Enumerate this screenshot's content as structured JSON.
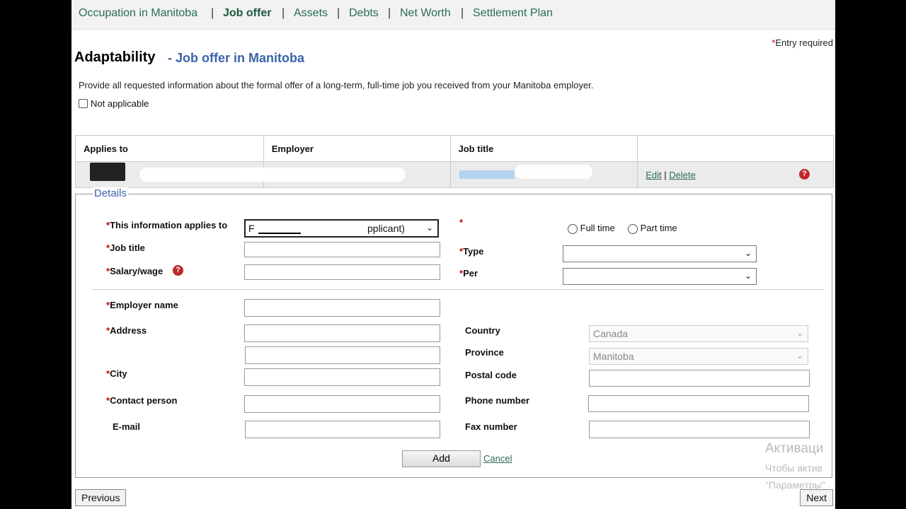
{
  "nav": {
    "items": [
      {
        "label": "Occupation in Manitoba",
        "active": false
      },
      {
        "label": "Job offer",
        "active": true
      },
      {
        "label": "Assets",
        "active": false
      },
      {
        "label": "Debts",
        "active": false
      },
      {
        "label": "Net Worth",
        "active": false
      },
      {
        "label": "Settlement Plan",
        "active": false
      }
    ],
    "separator": "|"
  },
  "entry_required": "Entry required",
  "required_marker": "*",
  "page_title": "Adaptability",
  "page_subtitle": "- Job offer in Manitoba",
  "intro": "Provide all requested information about the formal offer of a long-term, full-time job you received from your Manitoba employer.",
  "not_applicable_label": "Not applicable",
  "table": {
    "headers": [
      "Applies to",
      "Employer",
      "Job title",
      ""
    ],
    "row": {
      "edit": "Edit",
      "delete": "Delete",
      "separator": "|"
    }
  },
  "details": {
    "legend": "Details",
    "applies_to_label": "This information applies to",
    "applies_to_value_partial": "pplicant)",
    "full_time_label": "Full time",
    "part_time_label": "Part time",
    "job_title_label": "Job title",
    "type_label": "Type",
    "salary_label": "Salary/wage",
    "per_label": "Per",
    "employer_name_label": "Employer name",
    "address_label": "Address",
    "country_label": "Country",
    "country_value": "Canada",
    "province_label": "Province",
    "province_value": "Manitoba",
    "city_label": "City",
    "postal_label": "Postal code",
    "contact_label": "Contact person",
    "phone_label": "Phone number",
    "email_label": "E-mail",
    "fax_label": "Fax number",
    "add_button": "Add",
    "cancel_link": "Cancel"
  },
  "footer": {
    "previous": "Previous",
    "next": "Next"
  },
  "watermark": [
    "Активаци",
    "Чтобы актив",
    "\"Параметры\""
  ]
}
